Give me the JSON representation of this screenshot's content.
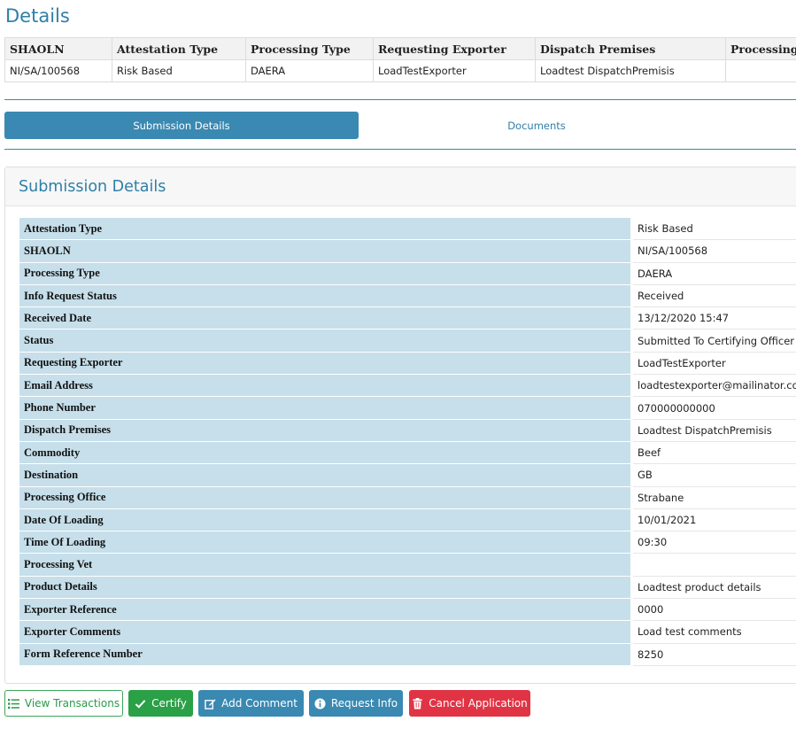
{
  "page_title": "Details",
  "summary": {
    "headers": [
      "SHAOLN",
      "Attestation Type",
      "Processing Type",
      "Requesting Exporter",
      "Dispatch Premises",
      "Processing Vet"
    ],
    "row": [
      "NI/SA/100568",
      "Risk Based",
      "DAERA",
      "LoadTestExporter",
      "Loadtest DispatchPremisis",
      ""
    ]
  },
  "tabs": [
    {
      "label": "Submission Details",
      "active": true
    },
    {
      "label": "Documents",
      "active": false
    }
  ],
  "panel": {
    "title": "Submission Details",
    "rows": [
      {
        "key": "Attestation Type",
        "value": "Risk Based"
      },
      {
        "key": "SHAOLN",
        "value": "NI/SA/100568"
      },
      {
        "key": "Processing Type",
        "value": "DAERA"
      },
      {
        "key": "Info Request Status",
        "value": "Received"
      },
      {
        "key": "Received Date",
        "value": "13/12/2020 15:47"
      },
      {
        "key": "Status",
        "value": "Submitted To Certifying Officer"
      },
      {
        "key": "Requesting Exporter",
        "value": "LoadTestExporter"
      },
      {
        "key": "Email Address",
        "value": "loadtestexporter@mailinator.com"
      },
      {
        "key": "Phone Number",
        "value": "070000000000"
      },
      {
        "key": "Dispatch Premises",
        "value": "Loadtest DispatchPremisis"
      },
      {
        "key": "Commodity",
        "value": "Beef"
      },
      {
        "key": "Destination",
        "value": "GB"
      },
      {
        "key": "Processing Office",
        "value": "Strabane"
      },
      {
        "key": "Date Of Loading",
        "value": "10/01/2021"
      },
      {
        "key": "Time Of Loading",
        "value": "09:30"
      },
      {
        "key": "Processing Vet",
        "value": ""
      },
      {
        "key": "Product Details",
        "value": "Loadtest  product details"
      },
      {
        "key": "Exporter Reference",
        "value": "0000"
      },
      {
        "key": "Exporter Comments",
        "value": "Load test comments"
      },
      {
        "key": "Form Reference Number",
        "value": "8250"
      }
    ]
  },
  "buttons": {
    "view_transactions": "View Transactions",
    "certify": "Certify",
    "add_comment": "Add Comment",
    "request_info": "Request Info",
    "cancel_application": "Cancel Application"
  },
  "colors": {
    "primary": "#3a89b2",
    "success": "#2aa047",
    "danger": "#e03445",
    "label_bg": "#c6dfea",
    "title": "#2f7fa8"
  },
  "icons": {
    "view_transactions": "list-icon",
    "certify": "check-icon",
    "add_comment": "edit-icon",
    "request_info": "info-circle-icon",
    "cancel_application": "trash-icon"
  }
}
